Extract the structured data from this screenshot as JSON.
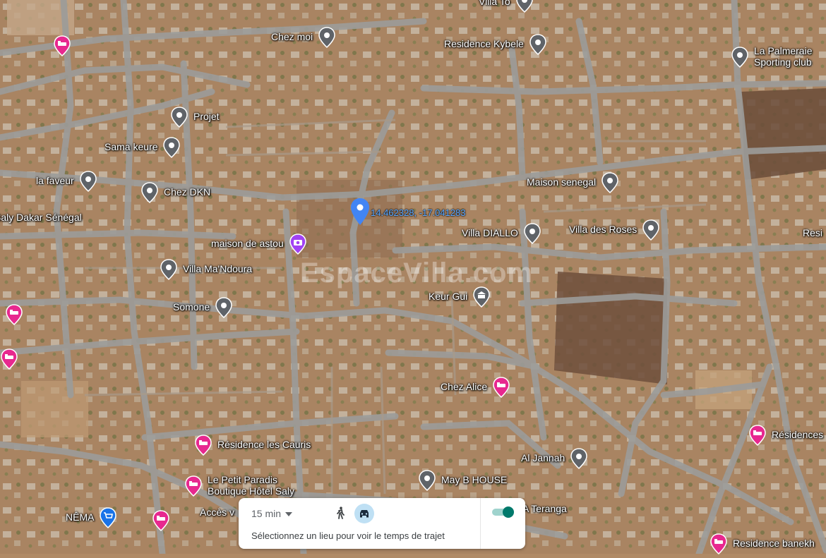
{
  "map": {
    "dropped_pin": {
      "coordinates": "14.462328, -17.041283",
      "color": "#4285f4"
    },
    "watermark": "EspaceVilla.com",
    "places": [
      {
        "id": "villa-to",
        "name": "Villa To",
        "icon": "location-pin-icon",
        "kind": "place"
      },
      {
        "id": "chez-moi",
        "name": "Chez moi",
        "icon": "location-pin-icon",
        "kind": "place"
      },
      {
        "id": "residence-kybele",
        "name": "Residence Kybele",
        "icon": "location-pin-icon",
        "kind": "place"
      },
      {
        "id": "la-palmeraie",
        "name": "La Palmeraie\nSporting club",
        "icon": "location-pin-icon",
        "kind": "place"
      },
      {
        "id": "projet",
        "name": "Projet",
        "icon": "location-pin-icon",
        "kind": "place"
      },
      {
        "id": "sama-keure",
        "name": "Sama keure",
        "icon": "location-pin-icon",
        "kind": "place"
      },
      {
        "id": "la-faveur",
        "name": "la faveur",
        "icon": "location-pin-icon",
        "kind": "place"
      },
      {
        "id": "chez-dkn",
        "name": "Chez DKN",
        "icon": "location-pin-icon",
        "kind": "place"
      },
      {
        "id": "maison-senegal",
        "name": "Maison senegal",
        "icon": "location-pin-icon",
        "kind": "place"
      },
      {
        "id": "saly-dakar",
        "name": "Saly Dakar Sénégal",
        "icon": "",
        "kind": "label"
      },
      {
        "id": "villa-diallo",
        "name": "Villa DIALLO",
        "icon": "location-pin-icon",
        "kind": "place"
      },
      {
        "id": "villa-des-roses",
        "name": "Villa des Roses",
        "icon": "location-pin-icon",
        "kind": "place"
      },
      {
        "id": "resi-right",
        "name": "Resi",
        "icon": "",
        "kind": "label"
      },
      {
        "id": "maison-de-astou",
        "name": "maison de astou",
        "icon": "camera-pin-icon",
        "kind": "photo"
      },
      {
        "id": "villa-mandoura",
        "name": "Villa Ma'Ndoura",
        "icon": "location-pin-icon",
        "kind": "place"
      },
      {
        "id": "keur-gui",
        "name": "Keur Gui",
        "icon": "bank-pin-icon",
        "kind": "place"
      },
      {
        "id": "somone",
        "name": "Somone",
        "icon": "location-pin-icon",
        "kind": "place"
      },
      {
        "id": "chez-alice",
        "name": "Chez Alice",
        "icon": "hotel-pin-icon",
        "kind": "hotel"
      },
      {
        "id": "residence-les-cauris",
        "name": "Résidence les Cauris",
        "icon": "hotel-pin-icon",
        "kind": "hotel"
      },
      {
        "id": "residences-right",
        "name": "Résidences",
        "icon": "hotel-pin-icon",
        "kind": "hotel"
      },
      {
        "id": "al-jannah",
        "name": "Al Jannah",
        "icon": "location-pin-icon",
        "kind": "place"
      },
      {
        "id": "le-petit-paradis",
        "name": "Le Petit Paradis\nBoutique Hôtel Saly",
        "icon": "hotel-pin-icon",
        "kind": "hotel"
      },
      {
        "id": "may-b-house",
        "name": "May B HOUSE",
        "icon": "location-pin-icon",
        "kind": "place"
      },
      {
        "id": "nema",
        "name": "NÊMA",
        "icon": "shopping-cart-pin-icon",
        "kind": "shop"
      },
      {
        "id": "acces",
        "name": "Accès v",
        "icon": "",
        "kind": "label"
      },
      {
        "id": "a-teranga",
        "name": "A Teranga",
        "icon": "",
        "kind": "label"
      },
      {
        "id": "residence-banekh",
        "name": "Residence banekh",
        "icon": "hotel-pin-icon",
        "kind": "hotel"
      }
    ],
    "extra_hotel_pins": 5,
    "colors": {
      "place_pin": "#5f6368",
      "hotel_pin": "#e7288f",
      "photo_pin": "#a142f4",
      "shop_pin": "#1a73e8",
      "road": "#9a9a9a",
      "ground": "#b08a66"
    }
  },
  "travel_panel": {
    "time_value": "15 min",
    "hint": "Sélectionnez un lieu pour voir le temps de trajet",
    "modes": [
      "walk-icon",
      "drive-icon"
    ],
    "selected_mode": "drive-icon",
    "toggle_on": true,
    "accent": "#00796b"
  }
}
